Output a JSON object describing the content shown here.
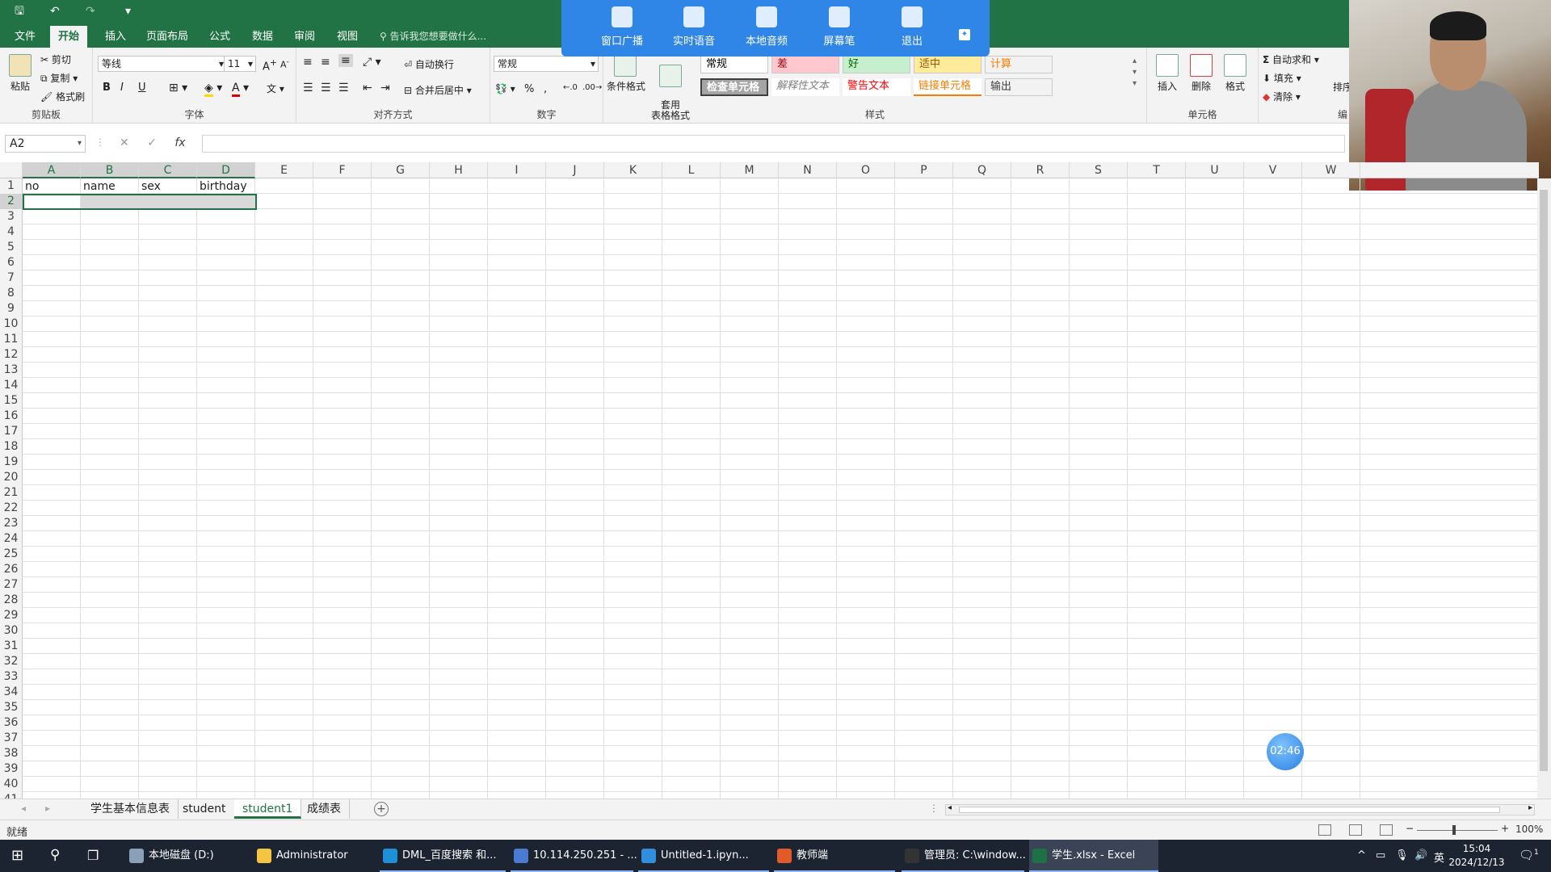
{
  "quick_access": {
    "save": "🖫",
    "undo": "↶",
    "redo": "↷",
    "customize": "▾"
  },
  "ribbon_tabs": [
    "文件",
    "开始",
    "插入",
    "页面布局",
    "公式",
    "数据",
    "审阅",
    "视图"
  ],
  "active_tab": "开始",
  "tell_me": "告诉我您想要做什么...",
  "ribbon": {
    "clipboard": {
      "paste": "粘贴",
      "cut": "剪切",
      "copy": "复制",
      "format_painter": "格式刷",
      "title": "剪贴板"
    },
    "font": {
      "name": "等线",
      "size": "11",
      "bold": "B",
      "italic": "I",
      "underline": "U",
      "title": "字体"
    },
    "alignment": {
      "wrap": "自动换行",
      "merge": "合并后居中",
      "title": "对齐方式"
    },
    "number": {
      "format": "常规",
      "percent": "%",
      "comma": ",",
      "title": "数字"
    },
    "styles": {
      "conditional": "条件格式",
      "table": "套用\n表格格式",
      "cells": [
        {
          "label": "常规",
          "bg": "#ffffff",
          "color": "#000000"
        },
        {
          "label": "差",
          "bg": "#ffc7ce",
          "color": "#9c0006"
        },
        {
          "label": "好",
          "bg": "#c6efce",
          "color": "#006100"
        },
        {
          "label": "适中",
          "bg": "#ffeb9c",
          "color": "#9c5700"
        },
        {
          "label": "计算",
          "bg": "#f2f2f2",
          "color": "#fa7d00"
        },
        {
          "label": "检查单元格",
          "bg": "#a5a5a5",
          "color": "#ffffff"
        },
        {
          "label": "解释性文本",
          "bg": "#ffffff",
          "color": "#7f7f7f"
        },
        {
          "label": "警告文本",
          "bg": "#ffffff",
          "color": "#ff0000"
        },
        {
          "label": "链接单元格",
          "bg": "#ffffff",
          "color": "#fa7d00"
        },
        {
          "label": "输出",
          "bg": "#f2f2f2",
          "color": "#3f3f3f"
        }
      ],
      "title": "样式"
    },
    "cells_group": {
      "insert": "插入",
      "delete": "删除",
      "format": "格式",
      "title": "单元格"
    },
    "editing": {
      "autosum": "自动求和",
      "fill": "填充",
      "clear": "清除",
      "sort": "排序",
      "title": "编"
    }
  },
  "float_toolbar": [
    "窗口广播",
    "实时语音",
    "本地音频",
    "屏幕笔",
    "退出"
  ],
  "namebox": "A2",
  "fx_label": "fx",
  "columns": [
    "A",
    "B",
    "C",
    "D",
    "E",
    "F",
    "G",
    "H",
    "I",
    "J",
    "K",
    "L",
    "M",
    "N",
    "O",
    "P",
    "Q",
    "R",
    "S",
    "T",
    "U",
    "V",
    "W"
  ],
  "row_count": 41,
  "cells": {
    "A1": "no",
    "B1": "name",
    "C1": "sex",
    "D1": "birthday"
  },
  "sheets": [
    "学生基本信息表",
    "student",
    "student1",
    "成绩表"
  ],
  "active_sheet": "student1",
  "status": "就绪",
  "zoom": "100%",
  "timer": "02:46",
  "taskbar": {
    "items": [
      {
        "label": "本地磁盘 (D:)",
        "icon": "drive-icon",
        "color": "#8aa0b8"
      },
      {
        "label": "Administrator",
        "icon": "folder-icon",
        "color": "#f5c542"
      },
      {
        "label": "DML_百度搜索 和...",
        "icon": "edge-icon",
        "color": "#1e90d6"
      },
      {
        "label": "10.114.250.251 - ...",
        "icon": "remote-desktop-icon",
        "color": "#4a7bd0"
      },
      {
        "label": "Untitled-1.ipyn...",
        "icon": "vscode-icon",
        "color": "#2f8fdd"
      },
      {
        "label": "教师端",
        "icon": "teacher-app-icon",
        "color": "#e05a2a"
      },
      {
        "label": "管理员: C:\\window...",
        "icon": "cmd-icon",
        "color": "#333333"
      },
      {
        "label": "学生.xlsx - Excel",
        "icon": "excel-icon",
        "color": "#1e7145"
      }
    ],
    "lang": "英",
    "time": "15:04",
    "date": "2024/12/13",
    "notifications": "1"
  }
}
